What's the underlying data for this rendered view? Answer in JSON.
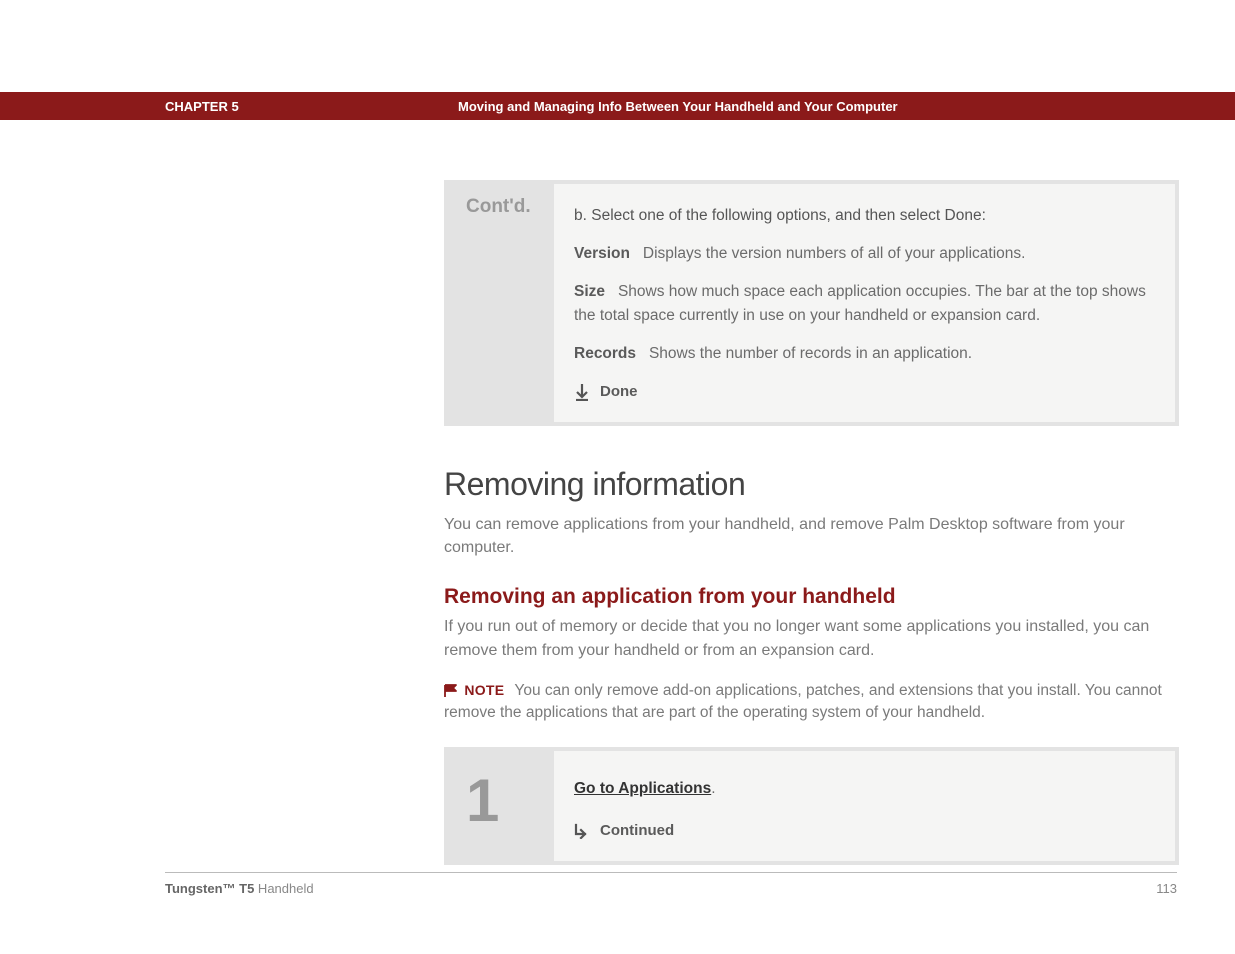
{
  "header": {
    "chapter_label": "CHAPTER 5",
    "chapter_title": "Moving and Managing Info Between Your Handheld and Your Computer"
  },
  "contd_box": {
    "label": "Cont'd.",
    "lead": "b.  Select one of the following options, and then select Done:",
    "options": {
      "version": {
        "label": "Version",
        "desc": "Displays the version numbers of all of your applications."
      },
      "size": {
        "label": "Size",
        "desc": "Shows how much space each application occupies. The bar at the top shows the total space currently in use on your handheld or expansion card."
      },
      "records": {
        "label": "Records",
        "desc": "Shows the number of records in an application."
      }
    },
    "done_label": "Done"
  },
  "section": {
    "heading": "Removing information",
    "body": "You can remove applications from your handheld, and remove Palm Desktop software from your computer."
  },
  "subsection": {
    "heading": "Removing an application from your handheld",
    "body": "If you run out of memory or decide that you no longer want some applications you installed, you can remove them from your handheld or from an expansion card.",
    "note_label": "NOTE",
    "note_body": "You can only remove add-on applications, patches, and extensions that you install. You cannot remove the applications that are part of the operating system of your handheld."
  },
  "step1": {
    "number": "1",
    "link_text": "Go to Applications",
    "link_suffix": ".",
    "continued_label": "Continued"
  },
  "footer": {
    "product_bold": "Tungsten™ T5",
    "product_rest": " Handheld",
    "page_number": "113"
  }
}
